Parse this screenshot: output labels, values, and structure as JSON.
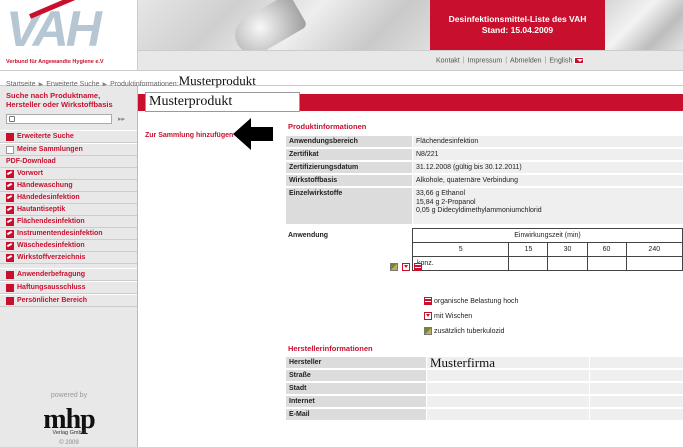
{
  "header": {
    "logo_text": "VAH",
    "logo_sub": "Verbund für Angewandte Hygiene e.V",
    "title_line1": "Desinfektionsmittel-Liste des VAH",
    "title_line2": "Stand: 15.04.2009",
    "nav": [
      "Kontakt",
      "Impressum",
      "Abmelden",
      "English"
    ]
  },
  "breadcrumb": {
    "items": [
      "Startseite",
      "Erweiterte Suche",
      "Produktinformationen:"
    ],
    "current": "Musterprodukt"
  },
  "sidebar": {
    "search_title": "Suche nach Produktname, Hersteller oder Wirkstoffbasis",
    "search_go": "▸▸",
    "items": [
      {
        "label": "Erweiterte Suche",
        "icon": "search-red-icon"
      },
      {
        "label": "Meine Sammlungen",
        "icon": "folder-icon"
      }
    ],
    "pdf_title": "PDF-Download",
    "pdf_items": [
      "Vorwort",
      "Händewaschung",
      "Händedesinfektion",
      "Hautantiseptik",
      "Flächendesinfektion",
      "Instrumentendesinfektion",
      "Wäschedesinfektion",
      "Wirkstoffverzeichnis"
    ],
    "bottom_items": [
      {
        "label": "Anwenderbefragung",
        "icon": "pen-icon"
      },
      {
        "label": "Haftungsausschluss",
        "icon": "paragraph-icon"
      },
      {
        "label": "Persönlicher Bereich",
        "icon": "person-icon"
      }
    ],
    "powered_by": "powered by",
    "mhp": "mhp",
    "mhp_sub": "Verlag GmbH",
    "copyright": "© 2009"
  },
  "main": {
    "title": "Musterprodukt",
    "add_link": "Zur Sammlung hinzufügen",
    "produkt_heading": "Produktinformationen",
    "produkt_rows": [
      {
        "k": "Anwendungsbereich",
        "v": "Flächendesinfektion"
      },
      {
        "k": "Zertifikat",
        "v": "N8/221"
      },
      {
        "k": "Zertifizierungsdatum",
        "v": "31.12.2008 (gültig bis 30.12.2011)"
      },
      {
        "k": "Wirkstoffbasis",
        "v": "Alkohole, quaternäre Verbindung"
      }
    ],
    "einzel_label": "Einzelwirkstoffe",
    "einzel_values": [
      "33,66 g Ethanol",
      "15,84 g 2-Propanol",
      "0,05 g Didecyldimethylammoniumchlorid"
    ],
    "anwendung_label": "Anwendung",
    "einwirk_label": "Einwirkungszeit (min)",
    "times": [
      "5",
      "15",
      "30",
      "60",
      "240"
    ],
    "konz_label": "konz.",
    "legend": [
      {
        "icon": "organic-load-icon",
        "text": "organische Belastung hoch"
      },
      {
        "icon": "wipe-icon",
        "text": "mit Wischen"
      },
      {
        "icon": "tuberculocidal-icon",
        "text": "zusätzlich tuberkulozid"
      }
    ],
    "hersteller_heading": "Herstellerinformationen",
    "hersteller_rows": [
      {
        "k": "Hersteller",
        "v": "Musterfirma"
      },
      {
        "k": "Straße",
        "v": ""
      },
      {
        "k": "Stadt",
        "v": ""
      },
      {
        "k": "Internet",
        "v": ""
      },
      {
        "k": "E-Mail",
        "v": ""
      }
    ]
  },
  "colors": {
    "accent": "#c8102e",
    "sidebar_bg": "#e8e8e8"
  }
}
